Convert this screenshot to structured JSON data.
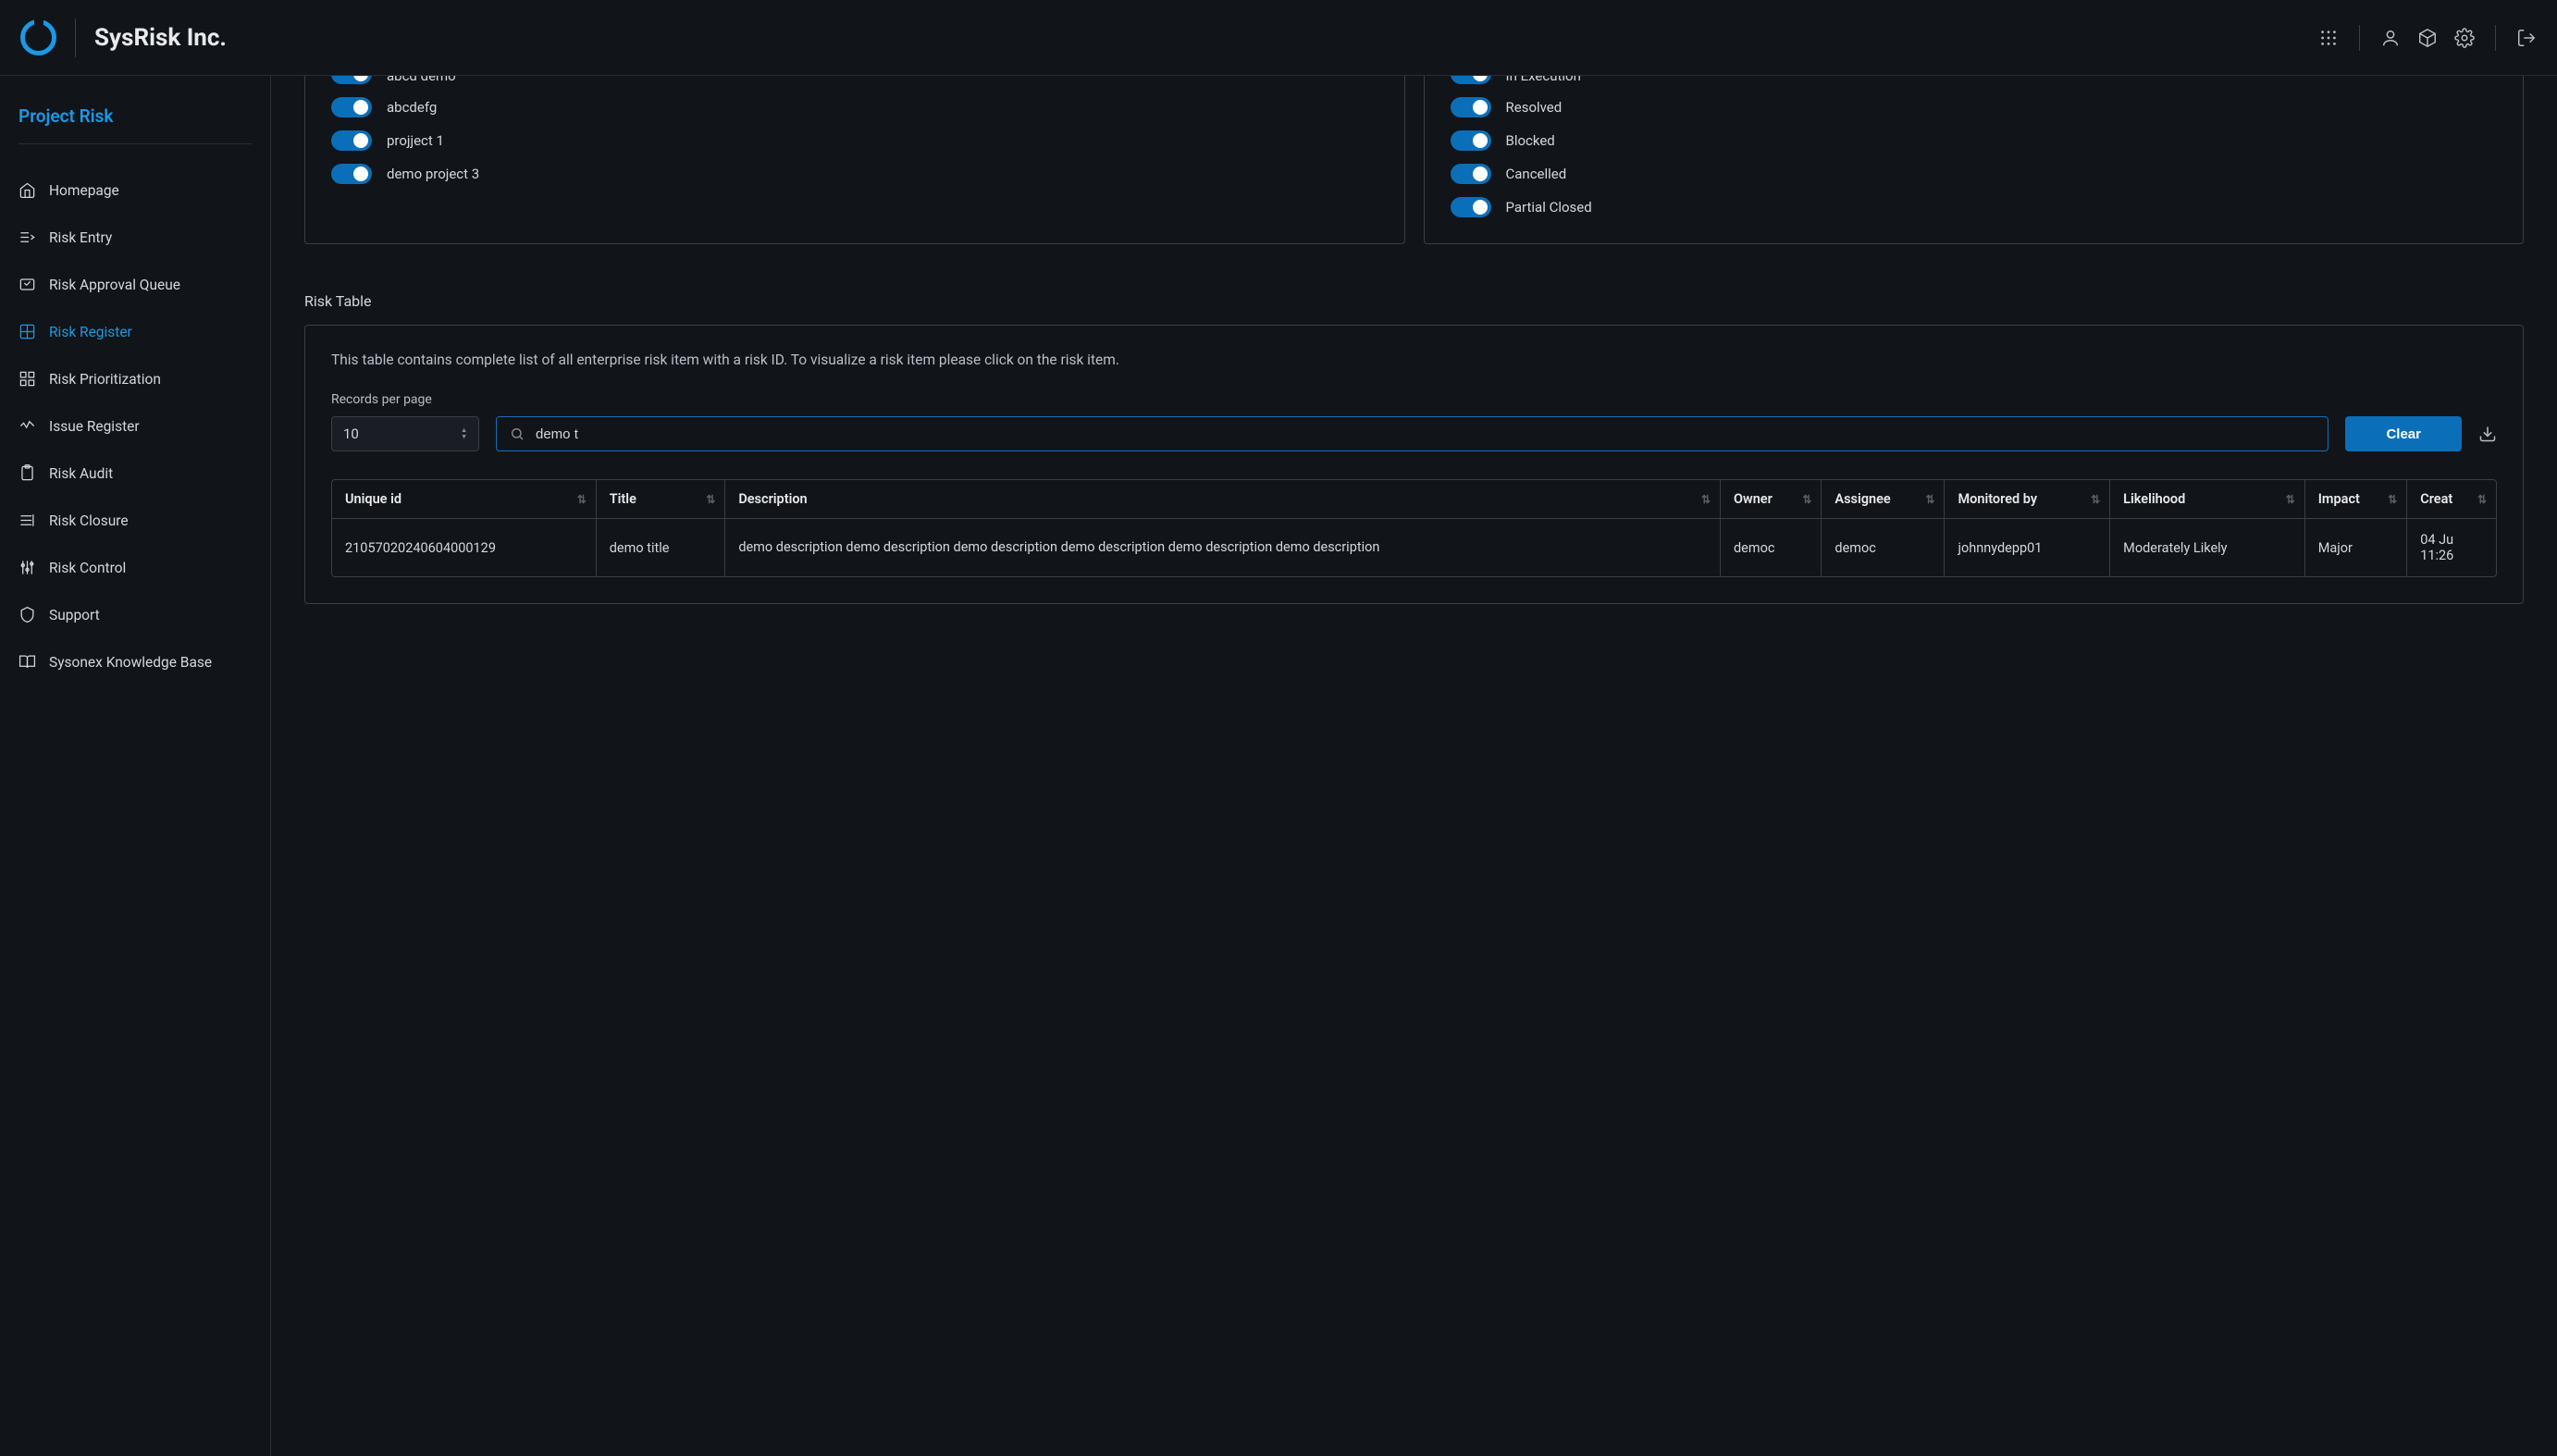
{
  "brand": "SysRisk Inc.",
  "sidebar": {
    "title": "Project Risk",
    "items": [
      {
        "icon": "home",
        "label": "Homepage"
      },
      {
        "icon": "entry",
        "label": "Risk Entry"
      },
      {
        "icon": "queue",
        "label": "Risk Approval Queue"
      },
      {
        "icon": "register",
        "label": "Risk Register",
        "active": true
      },
      {
        "icon": "prior",
        "label": "Risk Prioritization"
      },
      {
        "icon": "issue",
        "label": "Issue Register"
      },
      {
        "icon": "audit",
        "label": "Risk Audit"
      },
      {
        "icon": "closure",
        "label": "Risk Closure"
      },
      {
        "icon": "control",
        "label": "Risk Control"
      },
      {
        "icon": "support",
        "label": "Support"
      },
      {
        "icon": "kb",
        "label": "Sysonex Knowledge Base"
      }
    ]
  },
  "filters": {
    "left_cut": "abcd demo",
    "left": [
      "abcdefg",
      "projject 1",
      "demo project 3"
    ],
    "right_cut": "In Execution",
    "right": [
      "Resolved",
      "Blocked",
      "Cancelled",
      "Partial Closed"
    ]
  },
  "riskTable": {
    "heading": "Risk Table",
    "description": "This table contains complete list of all enterprise risk item with a risk ID. To visualize a risk item please click on the risk item.",
    "recordsLabel": "Records per page",
    "pageSize": "10",
    "searchValue": "demo t",
    "clearLabel": "Clear",
    "columns": [
      "Unique id",
      "Title",
      "Description",
      "Owner",
      "Assignee",
      "Monitored by",
      "Likelihood",
      "Impact",
      "Creat"
    ],
    "row": {
      "unique_id": "21057020240604000129",
      "title": "demo title",
      "description": "demo description demo description demo description demo description demo description demo description",
      "owner": "democ",
      "assignee": "democ",
      "monitored_by": "johnnydepp01",
      "likelihood": "Moderately Likely",
      "impact": "Major",
      "created": "04 Ju\n11:26"
    }
  }
}
